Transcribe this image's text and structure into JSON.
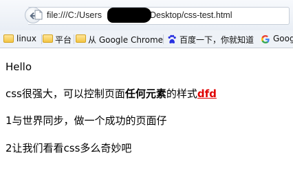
{
  "browser": {
    "url_visible_prefix": "file:///C:/Users",
    "url_visible_suffix": "Desktop/css-test.html",
    "back_icon": "back-arrow-icon",
    "page_icon": "page-icon"
  },
  "bookmarks": [
    {
      "label": "linux",
      "icon": "folder-icon"
    },
    {
      "label": "平台",
      "icon": "folder-icon"
    },
    {
      "label": "从 Google Chrome",
      "icon": "folder-icon"
    },
    {
      "label": "百度一下，你就知道",
      "icon": "baidu-paw-icon"
    },
    {
      "label": "Goog",
      "icon": "google-g-icon"
    }
  ],
  "content": {
    "line1": "Hello",
    "line2_prefix": "css很强大，可以控制页面",
    "line2_bold": "任何元素",
    "line2_mid": "的样式",
    "line2_link": "dfd",
    "line3": "1与世界同步，做一个成功的页面仔",
    "line4": "2让我们看看css多么奇妙吧"
  },
  "colors": {
    "link_red": "#e00000",
    "toolbar_bg": "#eef2f7"
  }
}
